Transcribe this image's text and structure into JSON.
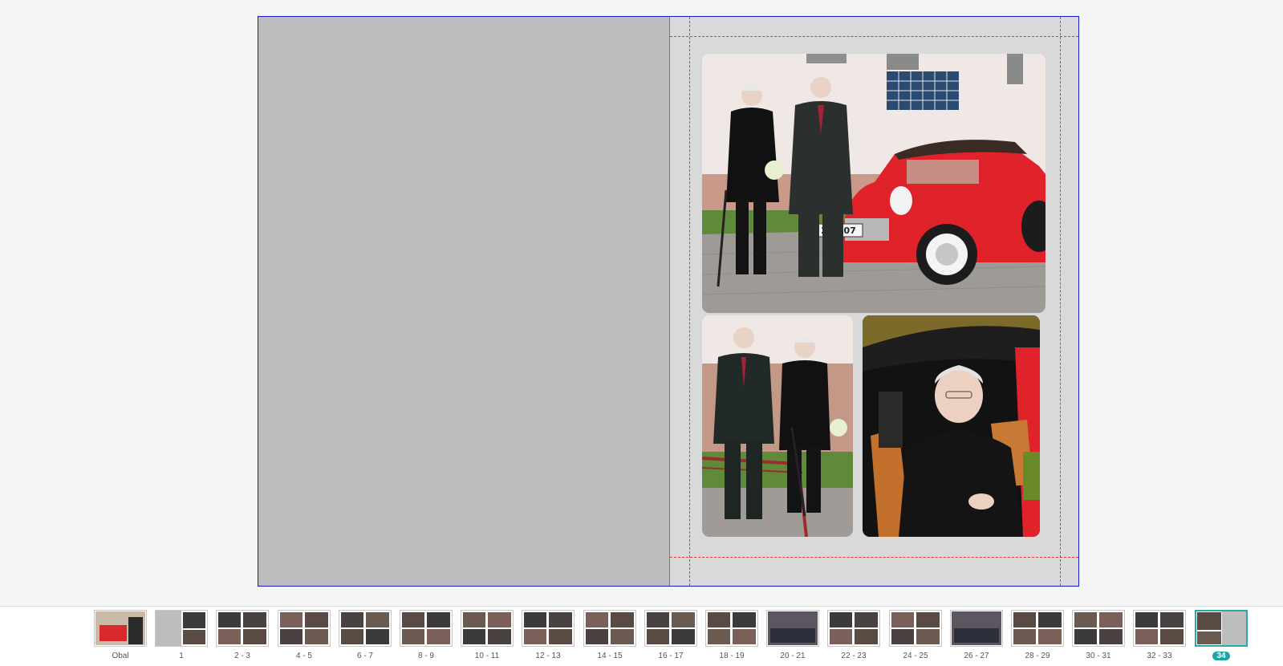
{
  "editor": {
    "active_spread": "34",
    "left_page": {
      "state": "empty"
    },
    "right_page": {
      "photos": [
        {
          "description": "couple-with-red-car"
        },
        {
          "description": "couple-standing"
        },
        {
          "description": "woman-in-car"
        }
      ],
      "license_plate": "2H  707"
    }
  },
  "filmstrip": {
    "thumbnails": [
      {
        "label": "Obal",
        "kind": "cover"
      },
      {
        "label": "1",
        "kind": "single-right"
      },
      {
        "label": "2 - 3",
        "kind": "grid"
      },
      {
        "label": "4 - 5",
        "kind": "grid"
      },
      {
        "label": "6 - 7",
        "kind": "grid"
      },
      {
        "label": "8 - 9",
        "kind": "grid"
      },
      {
        "label": "10 - 11",
        "kind": "grid"
      },
      {
        "label": "12 - 13",
        "kind": "grid"
      },
      {
        "label": "14 - 15",
        "kind": "grid"
      },
      {
        "label": "16 - 17",
        "kind": "grid"
      },
      {
        "label": "18 - 19",
        "kind": "grid"
      },
      {
        "label": "20 - 21",
        "kind": "panorama"
      },
      {
        "label": "22 - 23",
        "kind": "grid"
      },
      {
        "label": "24 - 25",
        "kind": "grid"
      },
      {
        "label": "26 - 27",
        "kind": "panorama"
      },
      {
        "label": "28 - 29",
        "kind": "grid"
      },
      {
        "label": "30 - 31",
        "kind": "grid"
      },
      {
        "label": "32 - 33",
        "kind": "grid"
      },
      {
        "label": "34",
        "kind": "single-left",
        "active": true
      }
    ]
  },
  "colors": {
    "spread_border": "#1a1acc",
    "guide_lines": "#e8323c",
    "active_accent": "#1aa6a6",
    "car_red": "#e0222a"
  }
}
